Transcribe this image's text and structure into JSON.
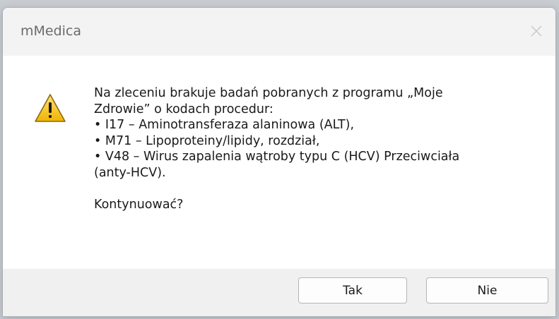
{
  "window": {
    "title": "mMedica",
    "close_icon": "close-icon"
  },
  "message": {
    "icon": "warning-icon",
    "lines": [
      "Na zleceniu brakuje badań pobranych z programu „Moje",
      "Zdrowie” o kodach procedur:",
      "• I17 – Aminotransferaza alaninowa (ALT),",
      "• M71 – Lipoproteiny/lipidy, rozdział,",
      "• V48 – Wirus zapalenia wątroby typu C (HCV) Przeciwciała",
      "(anty-HCV)."
    ],
    "question": "Kontynuować?"
  },
  "buttons": {
    "yes_label": "Tak",
    "no_label": "Nie"
  },
  "colors": {
    "warning_fill": "#f5c518",
    "warning_stroke": "#7a5a00",
    "titlebar_bg": "#f3f3f3",
    "footer_bg": "#f0f0f0"
  }
}
